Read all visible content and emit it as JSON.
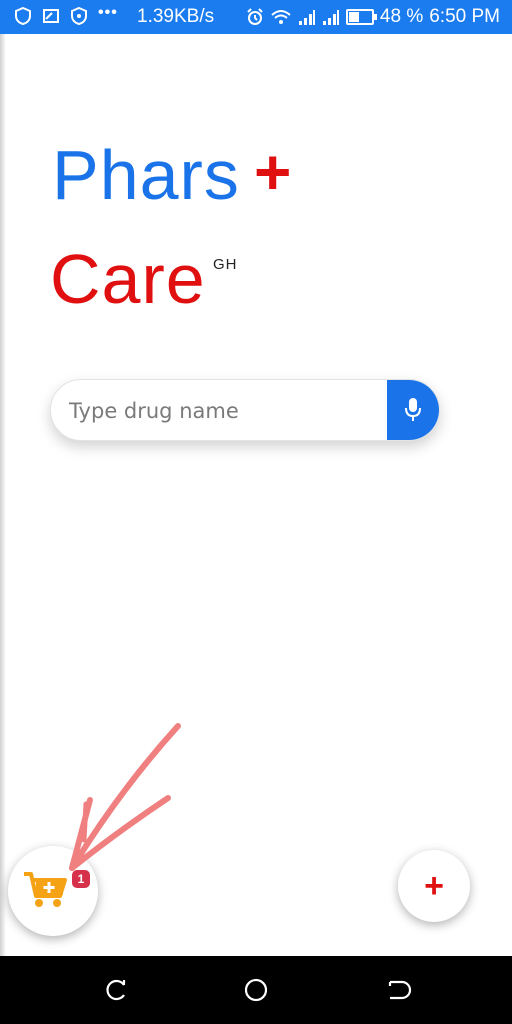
{
  "status_bar": {
    "network_speed": "1.39KB/s",
    "battery_percent": "48 %",
    "battery_level": 0.48,
    "time": "6:50 PM",
    "left_icons": [
      "shield-icon",
      "cast-icon",
      "vpn-shield-icon",
      "more-dots-icon"
    ],
    "right_icons": [
      "alarm-icon",
      "wifi-icon",
      "signal-icon",
      "signal-icon",
      "battery-icon"
    ]
  },
  "app": {
    "logo_primary": "Phars",
    "logo_plus": "+",
    "logo_secondary": "Care",
    "logo_superscript": "GH"
  },
  "search": {
    "placeholder": "Type drug name",
    "mic_icon": "microphone-icon"
  },
  "cart": {
    "icon": "cart-icon",
    "badge_count": "1"
  },
  "add_button": {
    "label": "+"
  },
  "nav_bar": {
    "icons": [
      "recent-apps-icon",
      "home-icon",
      "back-icon"
    ]
  },
  "colors": {
    "primary_blue": "#1a73e8",
    "status_bar_blue": "#1b7cf0",
    "accent_red": "#e01010",
    "cart_orange": "#f5a214",
    "badge_red": "#d6304a",
    "annotation_arrow": "#f08080"
  }
}
